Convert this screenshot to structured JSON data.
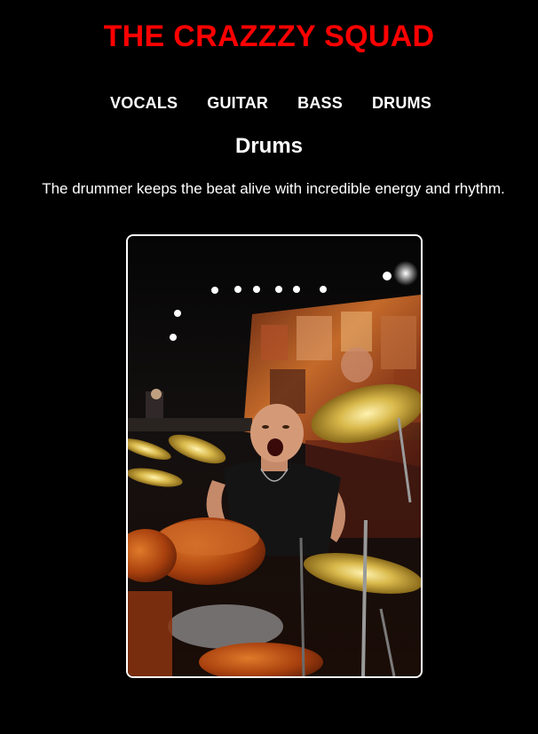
{
  "site": {
    "title": "THE CRAZZZY SQUAD",
    "title_color": "#ff0000",
    "background": "#000000"
  },
  "nav": {
    "items": [
      {
        "label": "VOCALS"
      },
      {
        "label": "GUITAR"
      },
      {
        "label": "BASS"
      },
      {
        "label": "DRUMS"
      }
    ]
  },
  "section": {
    "title": "Drums",
    "description": "The drummer keeps the beat alive with incredible energy and rhythm."
  },
  "photo": {
    "subject": "drummer-on-stage-photo"
  }
}
